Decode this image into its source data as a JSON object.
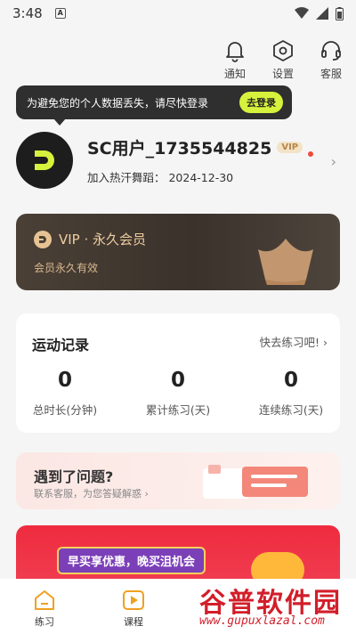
{
  "status_bar": {
    "time": "3:48",
    "a_badge": "A"
  },
  "top_actions": [
    {
      "label": "通知",
      "icon": "bell-icon"
    },
    {
      "label": "设置",
      "icon": "settings-hexagon-icon"
    },
    {
      "label": "客服",
      "icon": "headset-icon"
    }
  ],
  "tooltip": {
    "text": "为避免您的个人数据丢失，请尽快登录",
    "button": "去登录"
  },
  "profile": {
    "name": "SC用户_1735544825",
    "vip_badge": "VIP",
    "join_text": "加入热汗舞蹈：  2024-12-30"
  },
  "vip_card": {
    "title": "VIP · 永久会员",
    "subtitle": "会员永久有效"
  },
  "stats": {
    "title": "运动记录",
    "go_label": "快去练习吧!  ›",
    "items": [
      {
        "value": "0",
        "label": "总时长(分钟)"
      },
      {
        "value": "0",
        "label": "累计练习(天)"
      },
      {
        "value": "0",
        "label": "连续练习(天)"
      }
    ]
  },
  "help": {
    "title": "遇到了问题?",
    "subtitle": "联系客服，为您答疑解惑 ›"
  },
  "promo": {
    "pill": "早买享优惠，晚买沮机会"
  },
  "tabs": [
    {
      "label": "练习",
      "icon": "home-icon"
    },
    {
      "label": "课程",
      "icon": "play-icon"
    }
  ],
  "watermark": {
    "line1": "谷普软件园",
    "line2": "www.gupuxlazal.com"
  },
  "colors": {
    "accent": "#d7f23c",
    "vip_gold": "#f0cda1",
    "promo_red": "#ef2b3e"
  }
}
